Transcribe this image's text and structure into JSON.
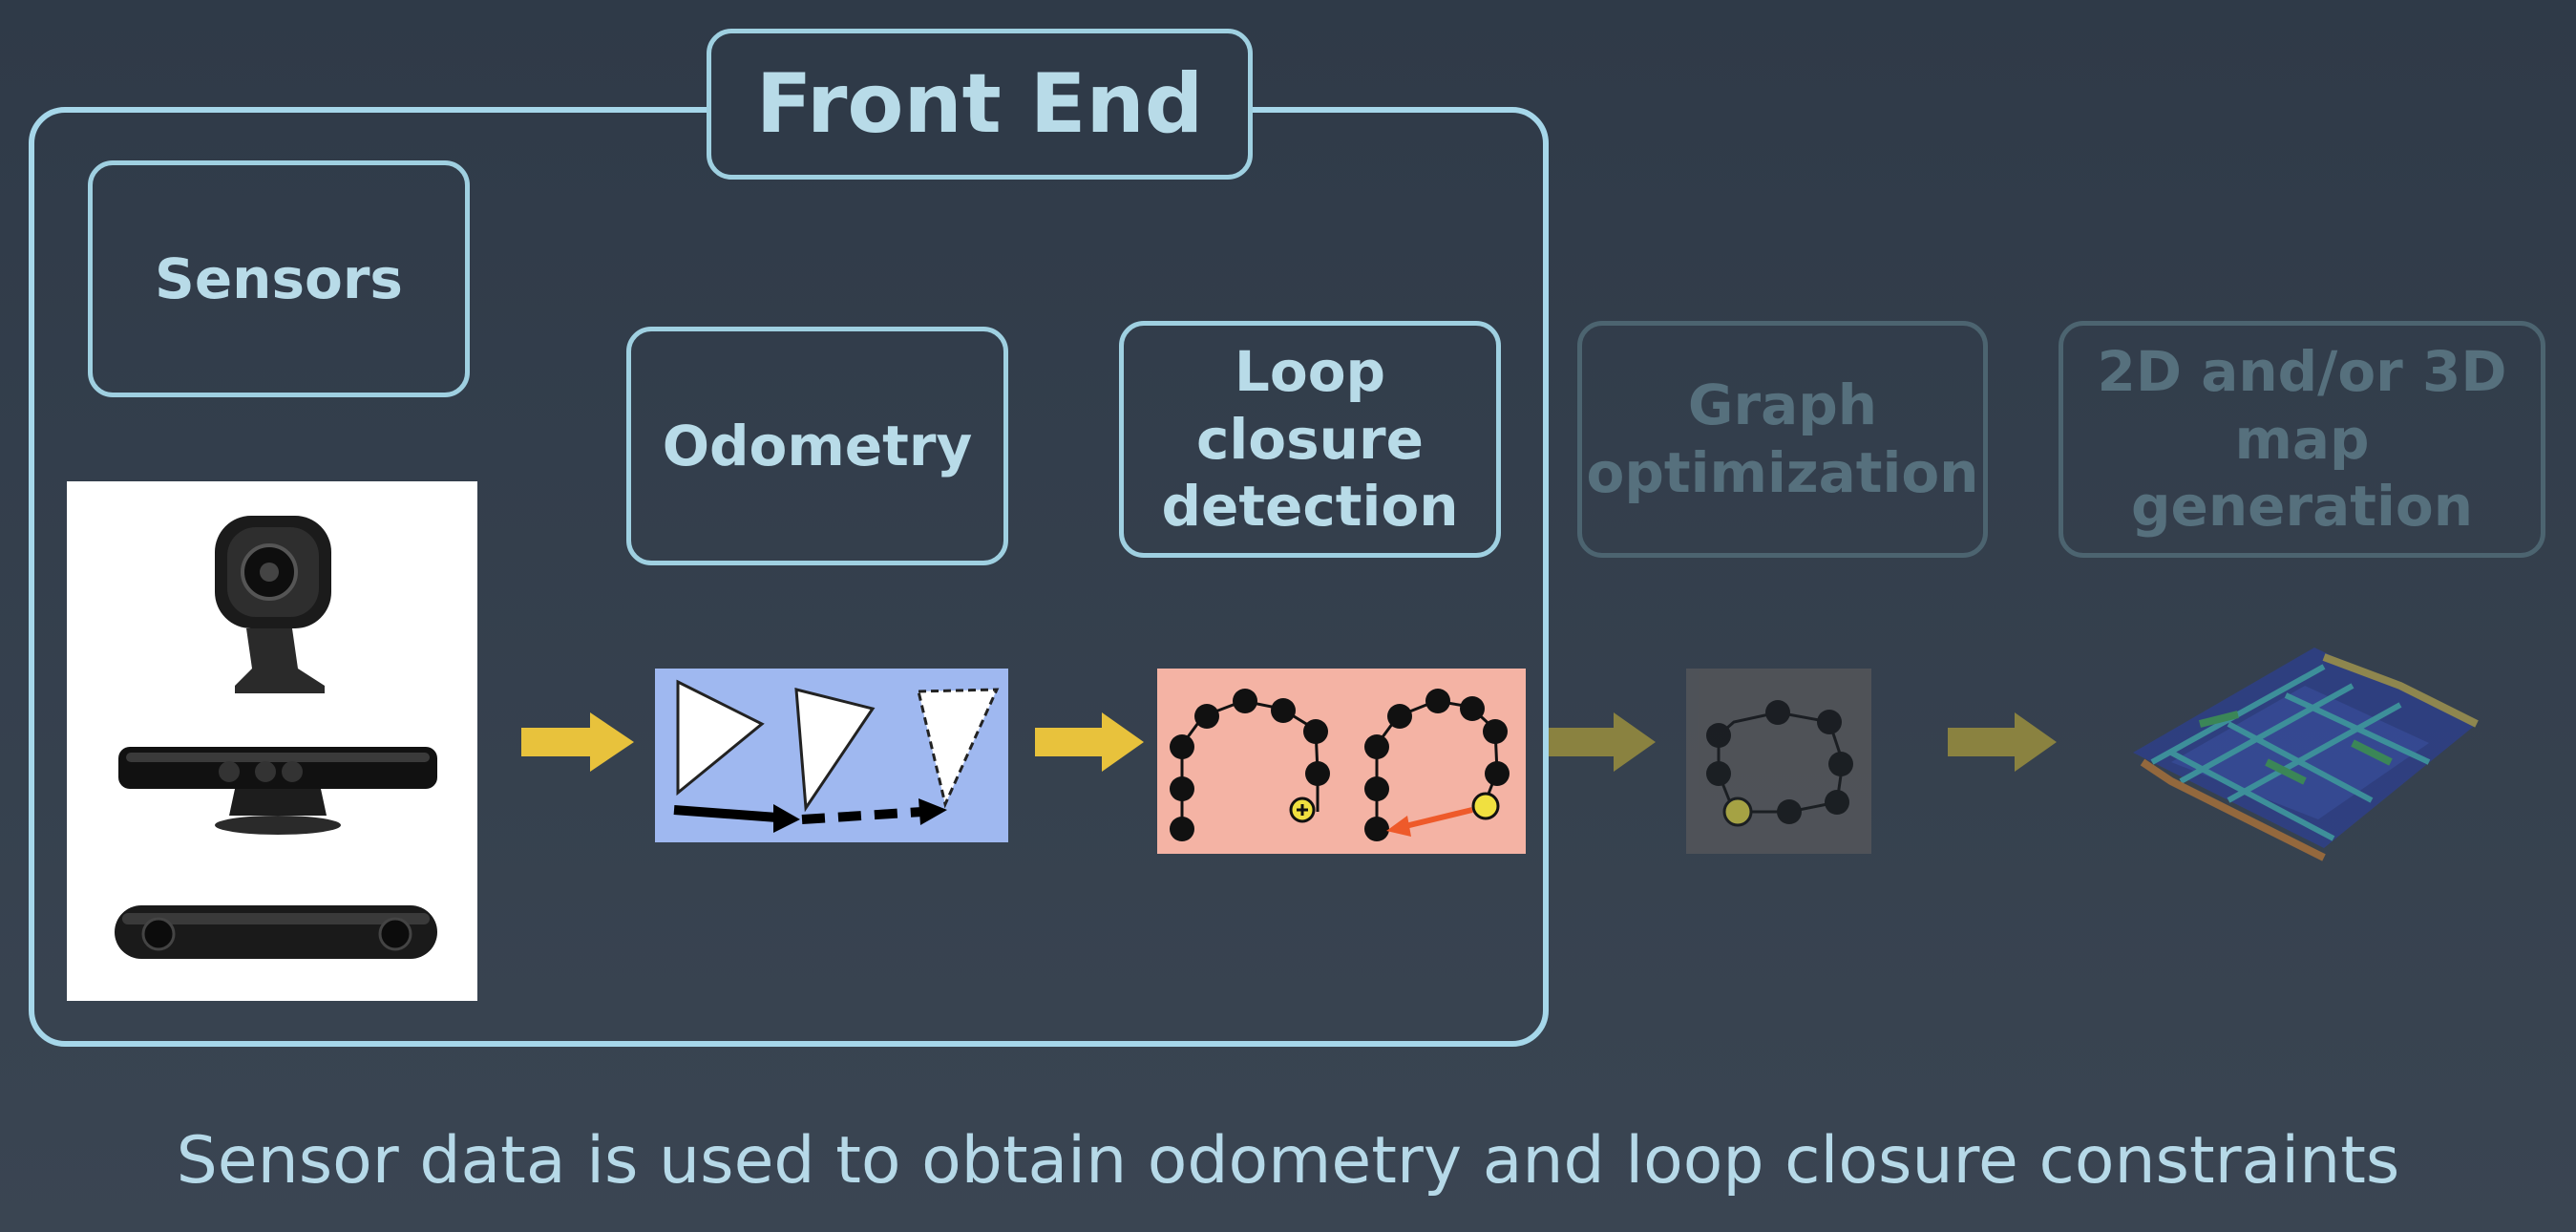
{
  "front_end": {
    "title": "Front End"
  },
  "stages": {
    "sensors": "Sensors",
    "odometry": "Odometry",
    "loop_closure": "Loop\nclosure\ndetection",
    "graph_optimization": "Graph\noptimization",
    "map_generation": "2D and/or 3D\nmap generation"
  },
  "caption": "Sensor data is used to obtain odometry and loop closure constraints",
  "colors": {
    "background": "#323d4a",
    "box_border": "#9fd0e1",
    "arrow_active": "#e8c23c",
    "arrow_dim": "#8a8240",
    "odometry_panel": "#9fb8f0",
    "loop_panel": "#f4b3a4",
    "loop_arrow": "#ee5a2a",
    "node_highlight": "#f0e040"
  },
  "icons": {
    "webcam": "webcam-icon",
    "kinect": "kinect-sensor-icon",
    "zed": "zed-stereo-camera-icon"
  }
}
